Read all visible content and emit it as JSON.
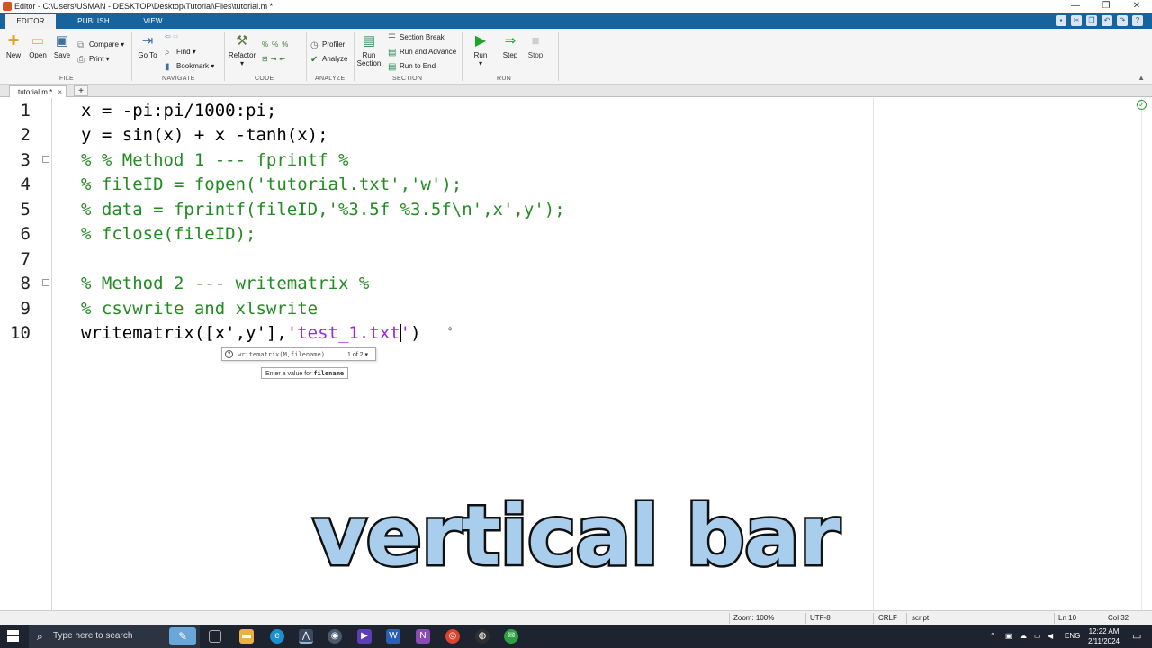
{
  "window": {
    "title": "Editor - C:\\Users\\USMAN - DESKTOP\\Desktop\\Tutorial\\Files\\tutorial.m *",
    "controls": [
      "—",
      "❐",
      "✕"
    ]
  },
  "ribbon_tabs": [
    "EDITOR",
    "PUBLISH",
    "VIEW"
  ],
  "ribbon": {
    "file": {
      "new": "New",
      "open": "Open",
      "save": "Save",
      "compare": "Compare",
      "print": "Print",
      "group": "FILE"
    },
    "navigate": {
      "goto": "Go To",
      "find": "Find",
      "bookmark": "Bookmark",
      "group": "NAVIGATE"
    },
    "code": {
      "refactor": "Refactor",
      "group": "CODE"
    },
    "analyze": {
      "profiler": "Profiler",
      "analyze": "Analyze",
      "group": "ANALYZE"
    },
    "section": {
      "run_section": "Run\nSection",
      "run_section_l1": "Run",
      "run_section_l2": "Section",
      "section_break": "Section Break",
      "run_and_advance": "Run and Advance",
      "run_to_end": "Run to End",
      "group": "SECTION"
    },
    "run": {
      "run": "Run",
      "step": "Step",
      "stop": "Stop",
      "group": "RUN"
    }
  },
  "doc_tab": {
    "name": "tutorial.m *",
    "close": "×",
    "add": "+"
  },
  "code": {
    "line_numbers": [
      "1",
      "2",
      "3",
      "4",
      "5",
      "6",
      "7",
      "8",
      "9",
      "10"
    ],
    "l1": "x = -pi:pi/1000:pi;",
    "l2": "y = sin(x) + x -tanh(x);",
    "l3": "% % Method 1 --- fprintf %",
    "l4": "% fileID = fopen('tutorial.txt','w');",
    "l5": "% data = fprintf(fileID,'%3.5f %3.5f\\n',x',y');",
    "l6": "% fclose(fileID);",
    "l7": "",
    "l8": "% Method 2 --- writematrix %",
    "l9": "% csvwrite and xlswrite",
    "l10_pre": "writematrix([x',y'],",
    "l10_str": "'test_1.txt",
    "l10_str_end": "'",
    "l10_post": ")"
  },
  "tooltip": {
    "icon": "?",
    "signature": "writematrix(M,filename)",
    "page": "1 of 2 ▾",
    "hint_prefix": "Enter a value for ",
    "hint_bold": "filename"
  },
  "caption": "vertical bar",
  "status": {
    "zoom": "Zoom: 100%",
    "encoding": "UTF-8",
    "eol": "CRLF",
    "type": "script",
    "line": "Ln  10",
    "col": "Col  32"
  },
  "taskbar": {
    "search_placeholder": "Type here to search",
    "language": "ENG",
    "time": "12:22 AM",
    "date": "2/11/2024"
  },
  "colors": {
    "matlab_blue": "#16639e",
    "comment_green": "#228b22",
    "string_purple": "#a020f0",
    "caption_fill": "#a9cdec"
  }
}
